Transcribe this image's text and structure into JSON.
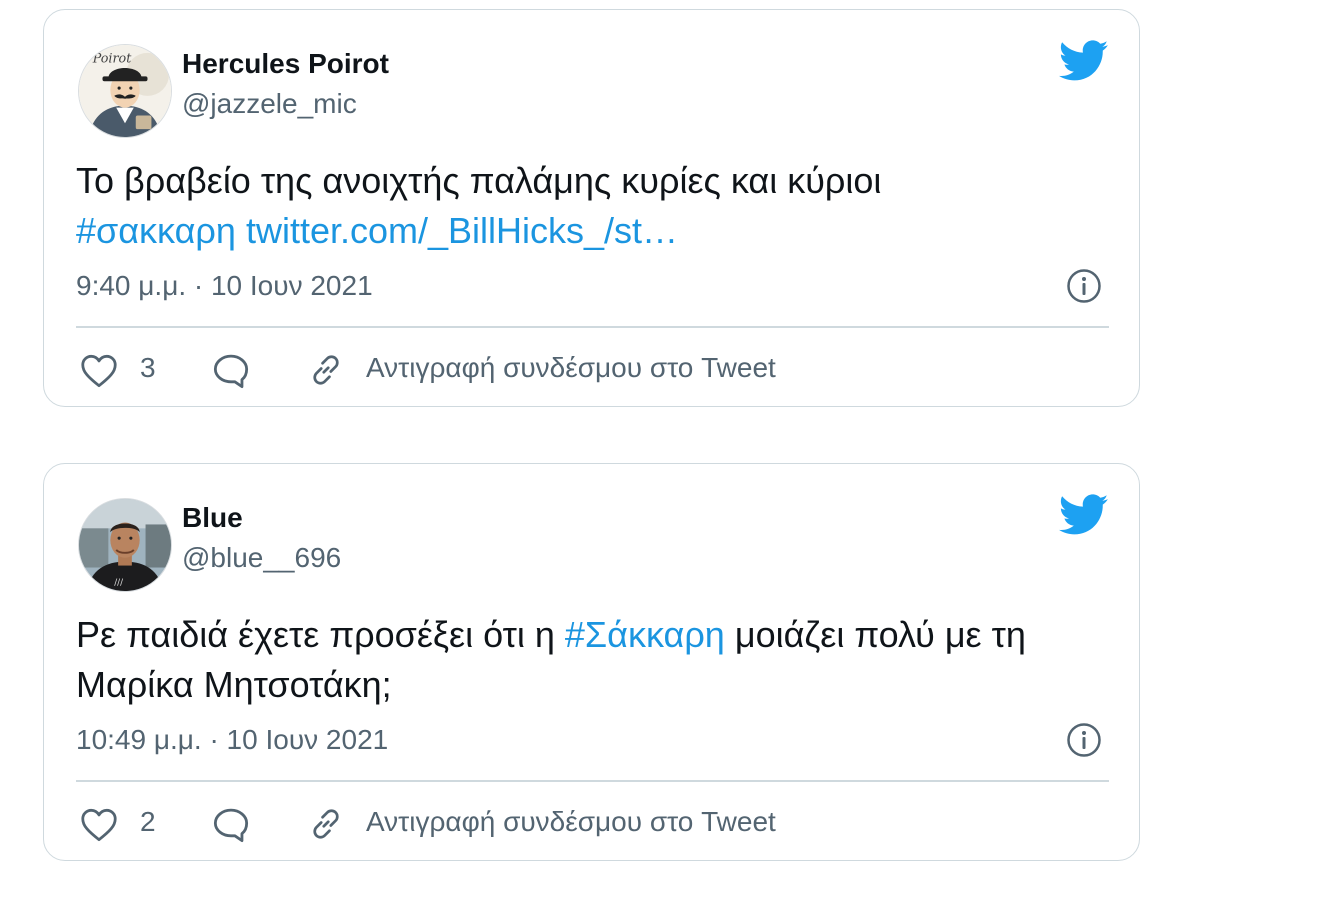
{
  "tweets": [
    {
      "display_name": "Hercules Poirot",
      "handle": "@jazzele_mic",
      "avatar_icon": "poirot-cartoon-avatar",
      "avatar_text": "Poirot",
      "text_line": "Το βραβείο της ανοιχτής παλάμης κυρίες και κύριοι",
      "hashtag": "#σακκαρη",
      "link": "twitter.com/_BillHicks_/st…",
      "timestamp": "9:40 μ.μ. · 10 Ιουν 2021",
      "like_count": "3",
      "copy_link_label": "Αντιγραφή συνδέσμου στο Tweet"
    },
    {
      "display_name": "Blue",
      "handle": "@blue__696",
      "avatar_icon": "man-photo-avatar",
      "text_before": "Ρε παιδιά έχετε προσέξει ότι η ",
      "hashtag": "#Σάκκαρη",
      "text_after": " μοιάζει πολύ με τη Μαρίκα Μητσοτάκη;",
      "timestamp": "10:49 μ.μ. · 10 Ιουν 2021",
      "like_count": "2",
      "copy_link_label": "Αντιγραφή συνδέσμου στο Tweet"
    }
  ],
  "colors": {
    "link": "#1b95e0",
    "twitter_blue": "#1da1f2",
    "secondary_text": "#536471",
    "border": "#cfd9de"
  }
}
